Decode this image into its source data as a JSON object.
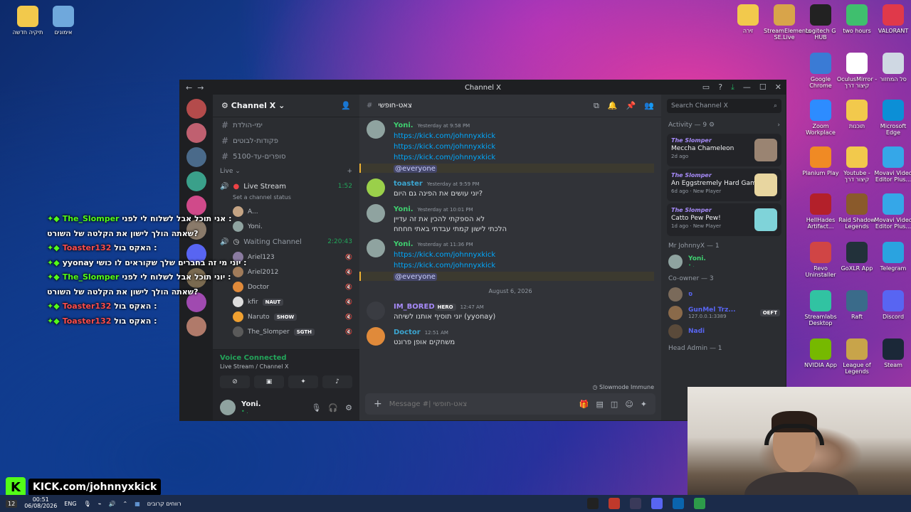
{
  "desktop": {
    "left_icons": [
      {
        "label": "תיקיה חדשה",
        "color": "#f2c94c"
      },
      {
        "label": "אימונים",
        "color": "#6fa8dc"
      }
    ],
    "right_icons": [
      {
        "label": "זירה",
        "color": "#f2c94c"
      },
      {
        "label": "StreamElements SE.Live",
        "color": "#d8a44a"
      },
      {
        "label": "Logitech G HUB",
        "color": "#222222"
      },
      {
        "label": "two hours",
        "color": "#3fbf6e"
      },
      {
        "label": "VALORANT",
        "color": "#e0394a"
      },
      {
        "label": "Google Chrome",
        "color": "#3a7bd5"
      },
      {
        "label": "OculusMirror - קיצור דרך",
        "color": "#ffffff"
      },
      {
        "label": "סל המחזור",
        "color": "#cfd8e3"
      },
      {
        "label": "Zoom Workplace",
        "color": "#2d8cff"
      },
      {
        "label": "תוכנות",
        "color": "#f2c94c"
      },
      {
        "label": "Microsoft Edge",
        "color": "#0c8fd6"
      },
      {
        "label": "Planium Play",
        "color": "#f08a24"
      },
      {
        "label": "Youtube - קיצור דרך",
        "color": "#f2c94c"
      },
      {
        "label": "Movavi Video Editor Plus...",
        "color": "#35a7e8"
      },
      {
        "label": "HellHades Artifact...",
        "color": "#b3202a"
      },
      {
        "label": "Raid Shadow Legends",
        "color": "#8a5a2b"
      },
      {
        "label": "Movavi Video Editor Plus...",
        "color": "#35a7e8"
      },
      {
        "label": "Revo Uninstaller",
        "color": "#d04545"
      },
      {
        "label": "GoXLR App",
        "color": "#22313a"
      },
      {
        "label": "Telegram",
        "color": "#2aa3e0"
      },
      {
        "label": "Streamlabs Desktop",
        "color": "#31c3a2"
      },
      {
        "label": "Raft",
        "color": "#3a6b8a"
      },
      {
        "label": "Discord",
        "color": "#5865f2"
      },
      {
        "label": "NVIDIA App",
        "color": "#76b900"
      },
      {
        "label": "League of Legends",
        "color": "#c8a44a"
      },
      {
        "label": "Steam",
        "color": "#1b2838"
      }
    ]
  },
  "window": {
    "title": "Channel X",
    "back": "←",
    "forward": "→"
  },
  "channels": {
    "guild_name": "Channel X",
    "text_channels": [
      {
        "name": "ימי-הולדת"
      },
      {
        "name": "פקודות-לבוטים"
      },
      {
        "name": "סופרים-עד-5100"
      }
    ],
    "live_category": "Live",
    "live_stream": {
      "name": "Live Stream",
      "time": "1:52",
      "status": "Set a channel status"
    },
    "live_users": [
      {
        "name": "A...",
        "color": "#c4a484"
      },
      {
        "name": "Yoni.",
        "color": "#8fa3a0"
      }
    ],
    "waiting_channel": {
      "name": "Waiting Channel",
      "time": "2:20:43"
    },
    "waiting_users": [
      {
        "name": "Ariel123",
        "color": "#8a7ba0",
        "tag": ""
      },
      {
        "name": "Ariel2012",
        "color": "#a07b5a",
        "tag": ""
      },
      {
        "name": "Doctor",
        "color": "#e08a3a",
        "tag": ""
      },
      {
        "name": "kfir",
        "color": "#dddddd",
        "tag": "NAUT"
      },
      {
        "name": "Naruto",
        "color": "#f0a030",
        "tag": "SHOW"
      },
      {
        "name": "The_Slomper",
        "color": "#5a5a5a",
        "tag": "SGTH"
      }
    ],
    "voice_panel": {
      "title": "Voice Connected",
      "subtitle": "Live Stream / Channel X"
    },
    "user": {
      "name": "Yoni.",
      "status": "• ."
    }
  },
  "chat": {
    "channel_name": "צאט-חופשי",
    "messages": [
      {
        "author": "Yoni.",
        "color": "#3fd070",
        "time": "Yesterday at 9:58 PM",
        "avatar": "#8fa3a0",
        "links": [
          "https://kick.com/johnnyxkick",
          "https://kick.com/johnnyxkick",
          "https://kick.com/johnnyxkick"
        ],
        "mention": "@everyone"
      },
      {
        "author": "toaster",
        "color": "#3ba5d0",
        "time": "Yesterday at 9:59 PM",
        "avatar": "#9ad04a",
        "lines": [
          "יוני עושים את הפינה גם היום?"
        ]
      },
      {
        "author": "Yoni.",
        "color": "#3fd070",
        "time": "Yesterday at 10:01 PM",
        "avatar": "#8fa3a0",
        "lines": [
          "לא הספקתי להכין את זה עדיין",
          "הלכתי לישון קמתי עבדתי באתי חחחח"
        ]
      },
      {
        "author": "Yoni.",
        "color": "#3fd070",
        "time": "Yesterday at 11:36 PM",
        "avatar": "#8fa3a0",
        "links": [
          "https://kick.com/johnnyxkick",
          "https://kick.com/johnnyxkick"
        ],
        "mention": "@everyone"
      }
    ],
    "date_divider": "August 6, 2026",
    "messages2": [
      {
        "author": "IM_BORED",
        "color": "#a78bfa",
        "time": "12:47 AM",
        "avatar": "#3a3c42",
        "badge": "HERO",
        "lines": [
          "יוני תוסיף אותנו לשיחה (yyonay)"
        ]
      },
      {
        "author": "Doctor",
        "color": "#3ba5d0",
        "time": "12:51 AM",
        "avatar": "#e08a3a",
        "lines": [
          "משחקים אופן פרונט"
        ]
      }
    ],
    "slowmode": "Slowmode Immune",
    "composer_placeholder": "Message #| צאט-חופשי"
  },
  "members": {
    "search_placeholder": "Search Channel X",
    "activity_label": "Activity — 9",
    "activities": [
      {
        "who": "The Slomper",
        "game": "Meccha Chameleon",
        "meta": "2d ago",
        "thumb": "#9a8472"
      },
      {
        "who": "The Slomper",
        "game": "An Eggstremely Hard Game",
        "meta": "6d ago · New Player",
        "thumb": "#e8d6a0"
      },
      {
        "who": "The Slomper",
        "game": "Catto Pew Pew!",
        "meta": "1d ago · New Player",
        "thumb": "#7fd3d9"
      }
    ],
    "owner_label": "Mr JohnnyX — 1",
    "owner": {
      "name": "Yoni.",
      "status": "• .",
      "color": "#8fa3a0"
    },
    "coowner_label": "Co-owner — 3",
    "coowners": [
      {
        "name": "ס",
        "color": "#7a6a5a",
        "status": ""
      },
      {
        "name": "GunMel Trz...",
        "color": "#8a6a4a",
        "status": "127.0.0.1:3389",
        "tag": "OEFT"
      },
      {
        "name": "Nadi",
        "color": "#5a4a3a",
        "status": ""
      }
    ],
    "head_admin_label": "Head Admin — 1"
  },
  "overlay": {
    "lines": [
      {
        "name": "The_Slomper",
        "style": "green",
        "text": "אני תוכל אבל לשלוח לי לפני :"
      },
      {
        "name": "",
        "style": "",
        "text": "שאתה הולך לישון את הקלטה של השורט?"
      },
      {
        "name": "Toaster132",
        "style": "red",
        "text": "האקס בול :"
      },
      {
        "name": "yyonay",
        "style": "yellow",
        "text": "יוני מי זה בחברים שלך שקוראים לו כושי :"
      },
      {
        "name": "The_Slomper",
        "style": "green",
        "text": "יוני תוכל אבל לשלוח לי לפני :"
      },
      {
        "name": "",
        "style": "",
        "text": "שאתה הולך לישון את הקלטה של השורט?"
      },
      {
        "name": "Toaster132",
        "style": "red",
        "text": "האקס בול :"
      },
      {
        "name": "Toaster132",
        "style": "red",
        "text": "האקס בול :"
      }
    ]
  },
  "kick": {
    "logo": "K",
    "url": "KICK.com/johnnyxkick"
  },
  "taskbar": {
    "notification_count": "12",
    "time": "00:51",
    "date": "06/08/2026",
    "lang": "ENG",
    "search_text": "רווחים קרובים"
  }
}
